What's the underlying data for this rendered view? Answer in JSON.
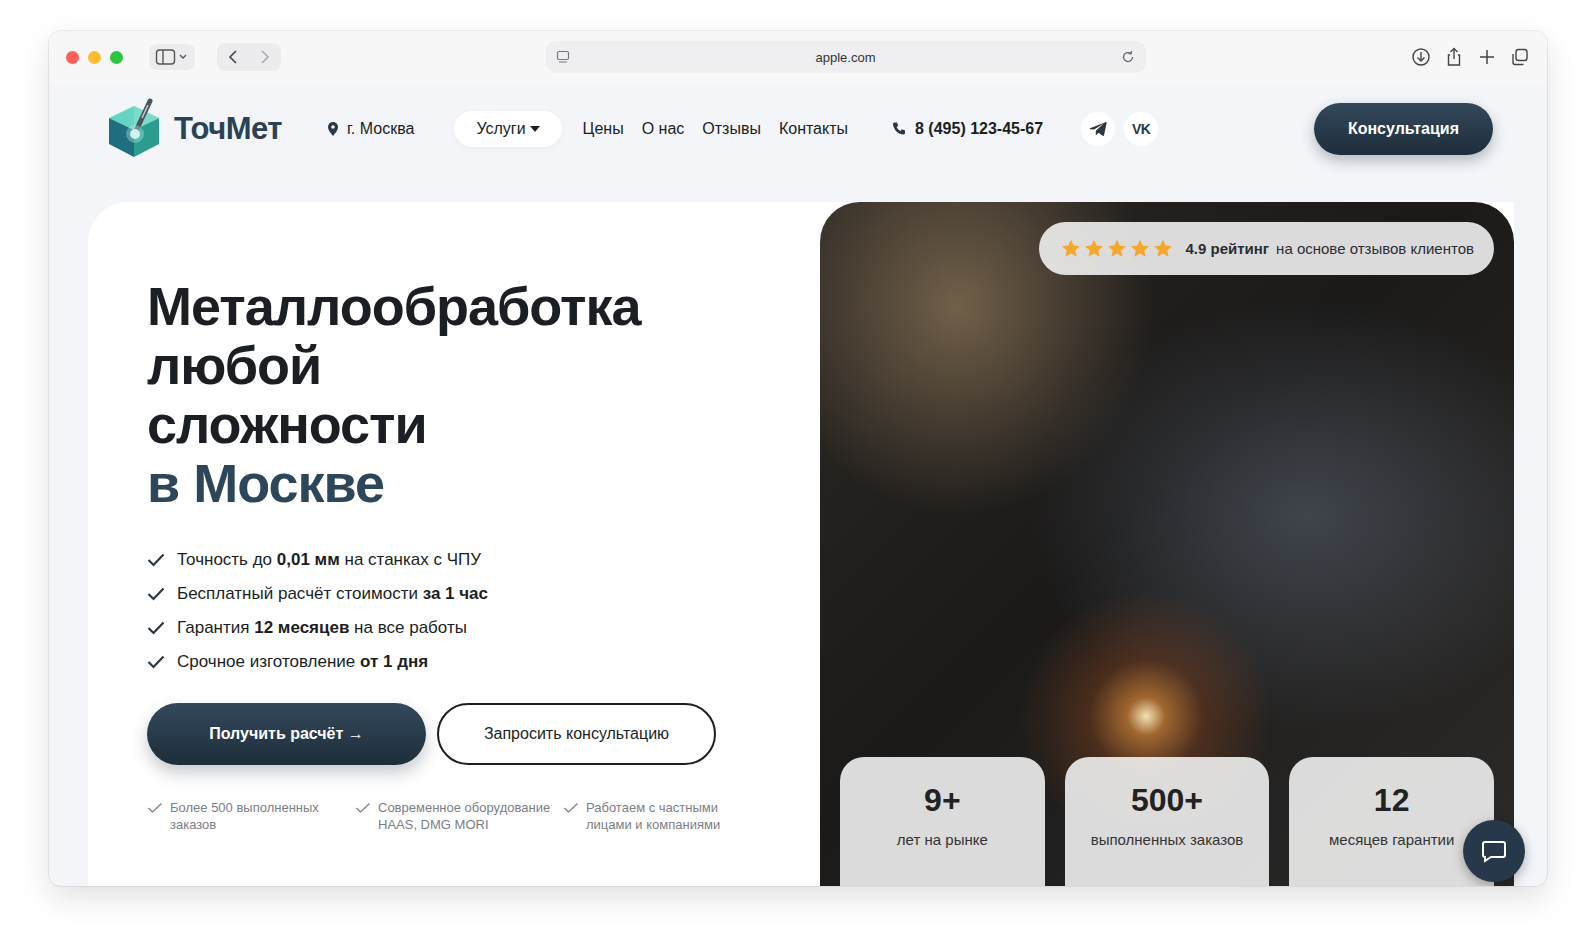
{
  "browser": {
    "url": "apple.com"
  },
  "header": {
    "logo": "ТочМет",
    "location": "г. Москва",
    "nav": [
      {
        "label": "Услуги",
        "selected": true,
        "dropdown": true
      },
      {
        "label": "Цены",
        "selected": false,
        "dropdown": false
      },
      {
        "label": "О нас",
        "selected": false,
        "dropdown": false
      },
      {
        "label": "Отзывы",
        "selected": false,
        "dropdown": false
      },
      {
        "label": "Контакты",
        "selected": false,
        "dropdown": false
      }
    ],
    "phone": "8 (495) 123-45-67",
    "social": [
      {
        "kind": "telegram"
      },
      {
        "kind": "vk",
        "label": "VK"
      }
    ],
    "cta": "Консультация"
  },
  "hero": {
    "title": [
      "Металлообработка",
      "любой",
      "сложности"
    ],
    "title_accent": "в Москве",
    "features": [
      {
        "parts": [
          {
            "text": "Точность до ",
            "bold": false
          },
          {
            "text": "0,01 мм",
            "bold": true
          },
          {
            "text": " на станках с ЧПУ",
            "bold": false
          }
        ]
      },
      {
        "parts": [
          {
            "text": "Бесплатный расчёт стоимости ",
            "bold": false
          },
          {
            "text": "за 1 час",
            "bold": true
          }
        ]
      },
      {
        "parts": [
          {
            "text": "Гарантия ",
            "bold": false
          },
          {
            "text": "12 месяцев",
            "bold": true
          },
          {
            "text": " на все работы",
            "bold": false
          }
        ]
      },
      {
        "parts": [
          {
            "text": "Срочное изготовление ",
            "bold": false
          },
          {
            "text": "от 1 дня",
            "bold": true
          }
        ]
      }
    ],
    "primary_button": "Получить расчёт →",
    "secondary_button": "Запросить консультацию",
    "badges": [
      "Более 500 выполненных заказов",
      "Современное оборудование HAAS, DMG MORI",
      "Работаем с частными лицами и компаниями"
    ]
  },
  "rating": {
    "stars": 5,
    "score": "4.9 рейтинг",
    "caption": "на основе отзывов клиентов"
  },
  "stats": [
    {
      "value": "9+",
      "label": "лет на рынке"
    },
    {
      "value": "500+",
      "label": "выполненных заказов"
    },
    {
      "value": "12",
      "label": "месяцев гарантии"
    }
  ]
}
